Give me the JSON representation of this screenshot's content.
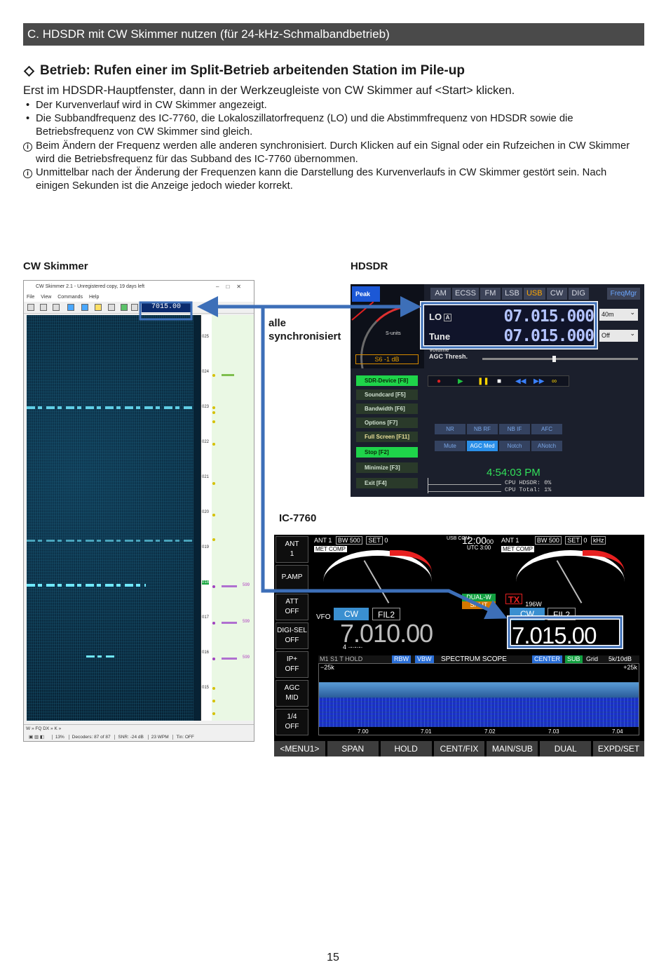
{
  "header": {
    "section": "C. HDSDR mit CW Skimmer nutzen (für 24-kHz-Schmalbandbetrieb)"
  },
  "heading": "Betrieb: Rufen einer im Split-Betrieb arbeitenden Station im Pile-up",
  "intro": "Erst im HDSDR-Hauptfenster, dann in der Werkzeugleiste von CW Skimmer auf <Start> klicken.",
  "bullets": [
    "Der Kurvenverlauf wird in CW Skimmer angezeigt.",
    "Die Subbandfrequenz des IC-7760, die Lokaloszillatorfrequenz (LO) und die Abstimmfrequenz von HDSDR sowie die Betriebsfrequenz von CW Skimmer sind gleich."
  ],
  "notes": [
    "Beim Ändern der Frequenz werden alle anderen synchronisiert. Durch Klicken auf ein Signal oder ein Rufzeichen in CW Skimmer wird die Betriebsfrequenz für das Subband des IC-7760 übernommen.",
    "Unmittelbar nach der Änderung der Frequenzen kann die Darstellung des Kurvenverlaufs in CW Skimmer gestört sein. Nach einigen Sekunden ist die Anzeige jedoch wieder korrekt."
  ],
  "captions": {
    "cw_skimmer": "CW Skimmer",
    "hdsdr": "HDSDR",
    "ic7760": "IC-7760",
    "sync": [
      "alle",
      "synchronisiert"
    ]
  },
  "cw_skimmer": {
    "title": "CW Skimmer 2.1 - Unregistered copy, 19 days left",
    "menu": [
      "File",
      "View",
      "Commands",
      "Help"
    ],
    "freq": "7015.00",
    "ticks": [
      "025",
      "024",
      "023",
      "022",
      "021",
      "020",
      "019",
      "018",
      "017",
      "016",
      "015"
    ],
    "spot_rst": "599",
    "status_top": "W  » FQ DX »  K »",
    "status": [
      "13%",
      "Decoders: 87 of 87",
      "SNR: -24 dB",
      "23 WPM",
      "Tin: OFF"
    ]
  },
  "hdsdr": {
    "peak": "Peak",
    "modes": [
      "AM",
      "ECSS",
      "FM",
      "LSB",
      "USB",
      "CW",
      "DIG"
    ],
    "active_mode": "USB",
    "freqmgr": "FreqMgr",
    "lo_label": "LO",
    "lo_vfo": "A",
    "lo_freq": "07.015.000",
    "tune_label": "Tune",
    "tune_freq": "07.015.000",
    "sunits": "S-units",
    "smeter_value": "S6 -1 dB",
    "volume": "Volume",
    "agc": "AGC Thresh.",
    "right_selects": [
      "40m",
      "Off"
    ],
    "buttons_left": [
      "SDR-Device [F8]",
      "Soundcard [F5]",
      "Bandwidth [F6]",
      "Options [F7]",
      "Full Screen [F11]",
      "Stop [F2]",
      "Minimize [F3]",
      "Exit [F4]"
    ],
    "func_buttons": [
      "NR",
      "NB RF",
      "NB IF",
      "AFC",
      "Mute",
      "AGC Med",
      "Notch",
      "ANotch"
    ],
    "clock": "4:54:03 PM",
    "cpu": [
      "CPU HDSDR: 0%",
      "CPU Total: 1%"
    ]
  },
  "ic7760": {
    "left_buttons": [
      {
        "top": "ANT",
        "bottom": "1"
      },
      {
        "top": "P.AMP",
        "bottom": ""
      },
      {
        "top": "ATT",
        "bottom": "OFF"
      },
      {
        "top": "DIGI-SEL",
        "bottom": "OFF"
      },
      {
        "top": "IP+",
        "bottom": "OFF"
      },
      {
        "top": "AGC",
        "bottom": "MID"
      },
      {
        "top": "1/4",
        "bottom": "OFF"
      }
    ],
    "ant1": "ANT 1",
    "bw": "BW 500",
    "set": "SET",
    "zero": "0",
    "met_comp": "MET COMP",
    "usb_com": "USB COM",
    "clock": "12:00",
    "clock_sec": "00",
    "utc": "UTC  3:00",
    "ant2": "ANT 1",
    "bw2": "BW 500",
    "khz": "kHz",
    "vfo": "VFO",
    "mode1": "CW",
    "fil1": "FIL2",
    "freq_main": "7.010.00",
    "freq_main_sub": "4 ·-·-·-·",
    "dualw": "DUAL-W",
    "split": "SPLIT",
    "tx": "TX",
    "power": "196W",
    "mode2": "CW",
    "fil2": "FIL2",
    "freq_sub": "7.015.00",
    "scope_title": "SPECTRUM SCOPE",
    "scope_left": "M1 S1 T HOLD",
    "rbw": "RBW",
    "vbw": "VBW",
    "center": "CENTER",
    "sub": "SUB",
    "grid": "Grid",
    "span_db": "5k/10dB",
    "span_l": "−25k",
    "span_r": "+25k",
    "axis": [
      "7.00",
      "7.01",
      "7.02",
      "7.03",
      "7.04"
    ],
    "bottom_buttons": [
      "<MENU1>",
      "SPAN",
      "HOLD",
      "CENT/FIX",
      "MAIN/SUB",
      "DUAL",
      "EXPD/SET"
    ]
  },
  "page_number": "15"
}
